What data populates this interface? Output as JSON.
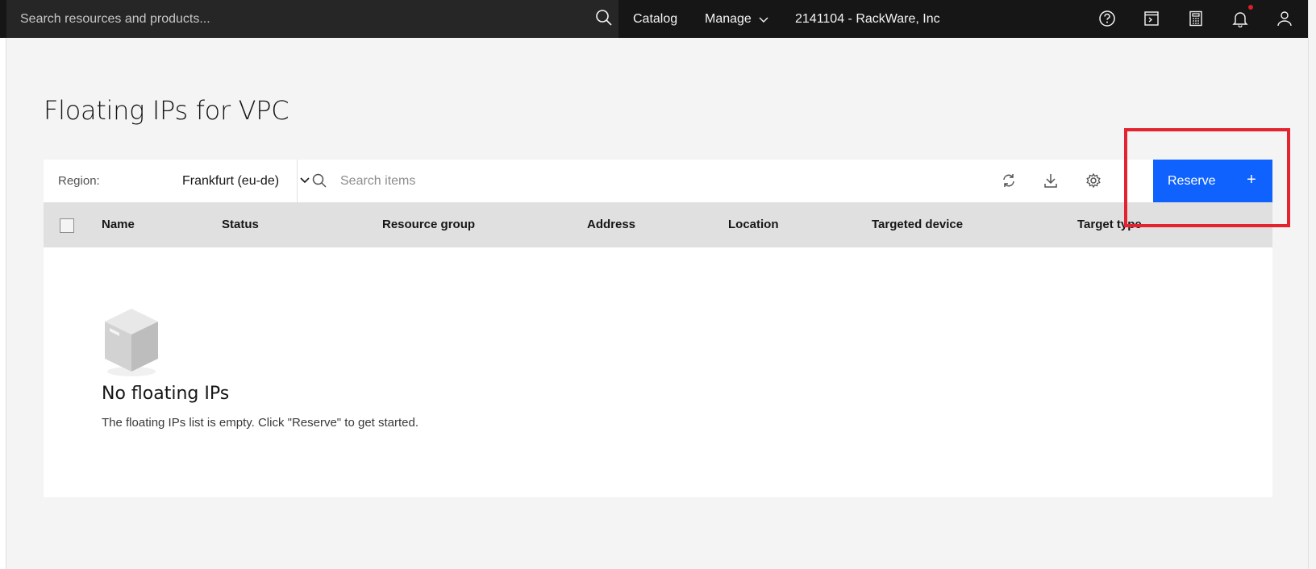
{
  "header": {
    "search_placeholder": "Search resources and products...",
    "nav": {
      "catalog": "Catalog",
      "manage": "Manage",
      "account": "2141104 - RackWare, Inc"
    },
    "icons": [
      "help-icon",
      "terminal-icon",
      "calculator-icon",
      "notification-icon",
      "user-icon"
    ]
  },
  "page": {
    "title": "Floating IPs for VPC"
  },
  "toolbar": {
    "region_label": "Region:",
    "region_value": "Frankfurt (eu-de)",
    "search_placeholder": "Search items",
    "reserve_label": "Reserve",
    "reserve_icon": "+"
  },
  "table": {
    "columns": [
      "Name",
      "Status",
      "Resource group",
      "Address",
      "Location",
      "Targeted device",
      "Target type"
    ]
  },
  "empty_state": {
    "title": "No floating IPs",
    "description": "The floating IPs list is empty. Click \"Reserve\" to get started."
  },
  "colors": {
    "primary": "#0f62fe",
    "header_bg": "#161616",
    "highlight": "#e3232f"
  }
}
